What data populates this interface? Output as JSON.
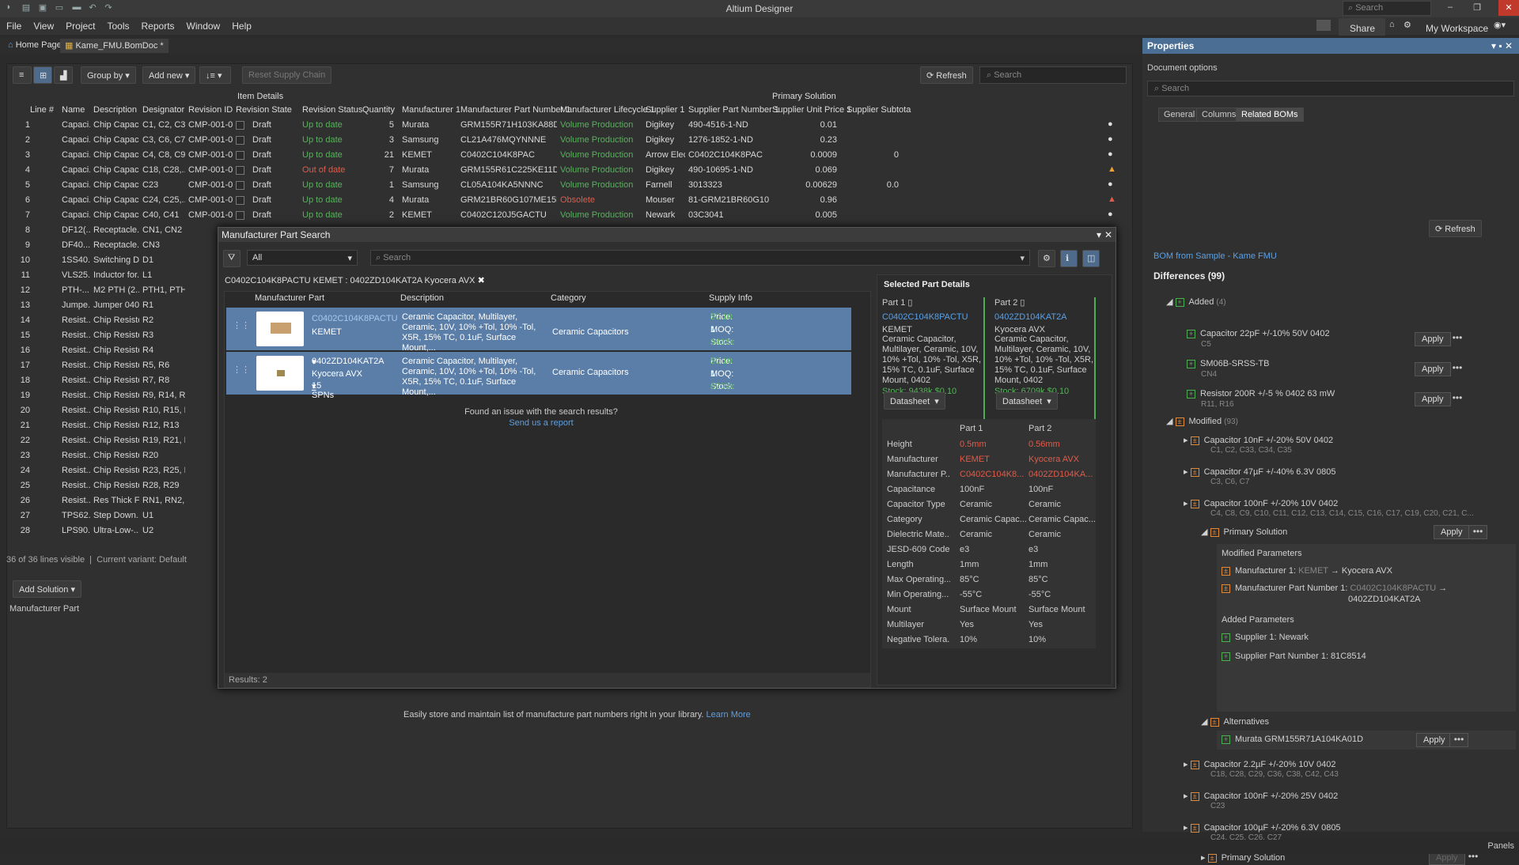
{
  "app": {
    "title": "Altium Designer",
    "search": "Search",
    "share": "Share",
    "workspace": "My Workspace"
  },
  "menu": [
    "File",
    "View",
    "Project",
    "Tools",
    "Reports",
    "Window",
    "Help"
  ],
  "doctabs": [
    "Home Page",
    "Kame_FMU.BomDoc *"
  ],
  "toolbar": {
    "group_by": "Group by",
    "add_new": "Add new",
    "reset": "Reset Supply Chain",
    "refresh": "Refresh",
    "search": "Search"
  },
  "grid": {
    "group_item": "Item Details",
    "group_primary": "Primary Solution",
    "headers": [
      "Line #",
      "Name",
      "Description",
      "Designator",
      "Revision ID",
      "Revision State",
      "Revision Status",
      "Quantity",
      "Manufacturer 1",
      "Manufacturer Part Number 1",
      "Manufacturer Lifecycle 1",
      "Supplier 1",
      "Supplier Part Number 1",
      "Supplier Unit Price 1",
      "Supplier Subtota"
    ],
    "rows": [
      [
        "1",
        "Capaci...",
        "Chip Capaci...",
        "C1, C2, C3,...",
        "CMP-001-0...",
        "Draft",
        "Up to date",
        "5",
        "Murata",
        "GRM155R71H103KA88D",
        "Volume Production",
        "Digikey",
        "490-4516-1-ND",
        "0.01",
        ""
      ],
      [
        "2",
        "Capaci...",
        "Chip Capaci...",
        "C3, C6, C7",
        "CMP-001-0...",
        "Draft",
        "Up to date",
        "3",
        "Samsung",
        "CL21A476MQYNNNE",
        "Volume Production",
        "Digikey",
        "1276-1852-1-ND",
        "0.23",
        ""
      ],
      [
        "3",
        "Capaci...",
        "Chip Capaci...",
        "C4, C8, C9,...",
        "CMP-001-0...",
        "Draft",
        "Up to date",
        "21",
        "KEMET",
        "C0402C104K8PAC",
        "Volume Production",
        "Arrow Elec...",
        "C0402C104K8PAC",
        "0.0009",
        "0"
      ],
      [
        "4",
        "Capaci...",
        "Chip Capaci...",
        "C18, C28,...",
        "CMP-001-0...",
        "Draft",
        "Out of date",
        "7",
        "Murata",
        "GRM155R61C225KE11D",
        "Volume Production",
        "Digikey",
        "490-10695-1-ND",
        "0.069",
        ""
      ],
      [
        "5",
        "Capaci...",
        "Chip Capaci...",
        "C23",
        "CMP-001-0...",
        "Draft",
        "Up to date",
        "1",
        "Samsung",
        "CL05A104KA5NNNC",
        "Volume Production",
        "Farnell",
        "3013323",
        "0.00629",
        "0.0"
      ],
      [
        "6",
        "Capaci...",
        "Chip Capaci...",
        "C24, C25,...",
        "CMP-001-0...",
        "Draft",
        "Up to date",
        "4",
        "Murata",
        "GRM21BR60G107ME15L",
        "Obsolete",
        "Mouser",
        "81-GRM21BR60G107...",
        "0.96",
        ""
      ],
      [
        "7",
        "Capaci...",
        "Chip Capaci...",
        "C40, C41",
        "CMP-001-0...",
        "Draft",
        "Up to date",
        "2",
        "KEMET",
        "C0402C120J5GACTU",
        "Volume Production",
        "Newark",
        "03C3041",
        "0.005",
        ""
      ],
      [
        "8",
        "DF12(...",
        "Receptacle...",
        "CN1, CN2"
      ],
      [
        "9",
        "DF40...",
        "Receptacle...",
        "CN3"
      ],
      [
        "10",
        "1SS40...",
        "Switching Di...",
        "D1"
      ],
      [
        "11",
        "VLS25...",
        "Inductor for...",
        "L1"
      ],
      [
        "12",
        "PTH-...",
        "M2 PTH (2...",
        "PTH1, PTH2"
      ],
      [
        "13",
        "Jumpe...",
        "Jumper 0402",
        "R1"
      ],
      [
        "14",
        "Resist...",
        "Chip Resisto...",
        "R2"
      ],
      [
        "15",
        "Resist...",
        "Chip Resisto...",
        "R3"
      ],
      [
        "16",
        "Resist...",
        "Chip Resisto...",
        "R4"
      ],
      [
        "17",
        "Resist...",
        "Chip Resisto...",
        "R5, R6"
      ],
      [
        "18",
        "Resist...",
        "Chip Resisto...",
        "R7, R8"
      ],
      [
        "19",
        "Resist...",
        "Chip Resisto...",
        "R9, R14, R1..."
      ],
      [
        "20",
        "Resist...",
        "Chip Resisto...",
        "R10, R15, R..."
      ],
      [
        "21",
        "Resist...",
        "Chip Resisto...",
        "R12, R13"
      ],
      [
        "22",
        "Resist...",
        "Chip Resisto...",
        "R19, R21, R..."
      ],
      [
        "23",
        "Resist...",
        "Chip Resisto...",
        "R20"
      ],
      [
        "24",
        "Resist...",
        "Chip Resisto...",
        "R23, R25, R..."
      ],
      [
        "25",
        "Resist...",
        "Chip Resisto...",
        "R28, R29"
      ],
      [
        "26",
        "Resist...",
        "Res Thick Fil...",
        "RN1, RN2,..."
      ],
      [
        "27",
        "TPS62...",
        "Step Down...",
        "U1"
      ],
      [
        "28",
        "LPS90...",
        "Ultra-Low-...",
        "U2"
      ]
    ],
    "status": "36 of 36 lines visible",
    "variant": "Current variant: Default"
  },
  "add_solution": "Add Solution",
  "manufacturer_part_label": "Manufacturer Part",
  "learn": {
    "text": "Easily store and maintain list of manufacture part numbers right in your library.",
    "link": "Learn More"
  },
  "dialog": {
    "title": "Manufacturer Part Search",
    "filter": "All",
    "search": "Search",
    "query": "C0402C104K8PACTU KEMET : 0402ZD104KAT2A Kyocera AVX",
    "cols": [
      "Manufacturer Part",
      "Description",
      "Category",
      "Supply Info"
    ],
    "parts": [
      {
        "mpn": "C0402C104K8PACTU",
        "mfr": "KEMET",
        "desc": "Ceramic Capacitor, Multilayer, Ceramic, 10V, 10% +Tol, 10% -Tol, X5R, 15% TC, 0.1uF, Surface Mount,...",
        "cat": "Ceramic Capacitors",
        "price_label": "Price:",
        "price": "$0.10",
        "moq_label": "MOQ:",
        "moq": "1",
        "stock_label": "Stock:",
        "stock": "9438k",
        "spns": ""
      },
      {
        "mpn": "0402ZD104KAT2A",
        "mfr": "Kyocera AVX",
        "desc": "Ceramic Capacitor, Multilayer, Ceramic, 10V, 10% +Tol, 10% -Tol, X5R, 15% TC, 0.1uF, Surface Mount,...",
        "cat": "Ceramic Capacitors",
        "price_label": "Price:",
        "price": "$0.10",
        "moq_label": "MOQ:",
        "moq": "1",
        "stock_label": "Stock:",
        "stock": "6709k",
        "spns": "15 SPNs"
      }
    ],
    "issue": "Found an issue with the search results?",
    "report": "Send us a report",
    "results": "Results: 2",
    "details_title": "Selected Part Details",
    "part1_label": "Part 1",
    "part2_label": "Part 2",
    "part1": {
      "mpn": "C0402C104K8PACTU",
      "mfr": "KEMET",
      "desc": "Ceramic Capacitor, Multilayer, Ceramic, 10V, 10% +Tol, 10% -Tol, X5R, 15% TC, 0.1uF, Surface Mount, 0402",
      "stock": "Stock: 9438k  $0.10"
    },
    "part2": {
      "mpn": "0402ZD104KAT2A",
      "mfr": "Kyocera AVX",
      "desc": "Ceramic Capacitor, Multilayer, Ceramic, 10V, 10% +Tol, 10% -Tol, X5R, 15% TC, 0.1uF, Surface Mount, 0402",
      "stock": "Stock: 6709k  $0.10"
    },
    "datasheet": "Datasheet",
    "compare_head": [
      "Part 1",
      "Part 2"
    ],
    "compare": [
      [
        "Height",
        "0.5mm",
        "0.56mm"
      ],
      [
        "Manufacturer",
        "KEMET",
        "Kyocera AVX"
      ],
      [
        "Manufacturer P...",
        "C0402C104K8...",
        "0402ZD104KA..."
      ],
      [
        "Capacitance",
        "100nF",
        "100nF"
      ],
      [
        "Capacitor Type",
        "Ceramic",
        "Ceramic"
      ],
      [
        "Category",
        "Ceramic Capac...",
        "Ceramic Capac..."
      ],
      [
        "Dielectric Mate...",
        "Ceramic",
        "Ceramic"
      ],
      [
        "JESD-609 Code",
        "e3",
        "e3"
      ],
      [
        "Length",
        "1mm",
        "1mm"
      ],
      [
        "Max Operating...",
        "85°C",
        "85°C"
      ],
      [
        "Min Operating...",
        "-55°C",
        "-55°C"
      ],
      [
        "Mount",
        "Surface Mount",
        "Surface Mount"
      ],
      [
        "Multilayer",
        "Yes",
        "Yes"
      ],
      [
        "Negative Tolera...",
        "10%",
        "10%"
      ]
    ]
  },
  "props": {
    "title": "Properties",
    "doc_options": "Document options",
    "search": "Search",
    "tabs": [
      "General",
      "Columns",
      "Related BOMs"
    ],
    "refresh": "Refresh",
    "bom_link": "BOM from Sample - Kame FMU",
    "differences": "Differences",
    "differences_count": "(99)",
    "added": "Added",
    "added_count": "(4)",
    "added_items": [
      [
        "Capacitor 22pF +/-10% 50V 0402",
        "C5"
      ],
      [
        "SM06B-SRSS-TB",
        "CN4"
      ],
      [
        "Resistor 200R +/-5 % 0402 63 mW",
        "R11, R16"
      ]
    ],
    "modified": "Modified",
    "modified_count": "(93)",
    "mod_items": [
      [
        "Capacitor 10nF +/-20% 50V 0402",
        "C1, C2, C33, C34, C35"
      ],
      [
        "Capacitor 47µF +/-40% 6.3V 0805",
        "C3, C6, C7"
      ],
      [
        "Capacitor 100nF +/-20% 10V 0402",
        "C4, C8, C9, C10, C11, C12, C13, C14, C15, C16, C17, C19, C20, C21, C..."
      ]
    ],
    "primary": "Primary Solution",
    "modified_params": "Modified Parameters",
    "mp1_label": "Manufacturer 1:",
    "mp1_old": "KEMET",
    "mp1_new": "→ Kyocera AVX",
    "mp2_label": "Manufacturer Part Number 1:",
    "mp2_old": "C0402C104K8PACTU",
    "mp2_arrow": "→",
    "mp2_new": "0402ZD104KAT2A",
    "added_params": "Added Parameters",
    "ap1": "Supplier 1: Newark",
    "ap2": "Supplier Part Number 1: 81C8514",
    "alternatives": "Alternatives",
    "alt1": "Murata GRM155R71A104KA01D",
    "more_items": [
      [
        "Capacitor 2.2µF +/-20% 10V 0402",
        "C18, C28, C29, C36, C38, C42, C43"
      ],
      [
        "Capacitor 100nF +/-20% 25V 0402",
        "C23"
      ],
      [
        "Capacitor 100µF +/-20% 6.3V 0805",
        "C24, C25, C26, C27"
      ]
    ],
    "apply": "Apply",
    "more": "•••"
  },
  "statusbar": {
    "panels": "Panels"
  }
}
